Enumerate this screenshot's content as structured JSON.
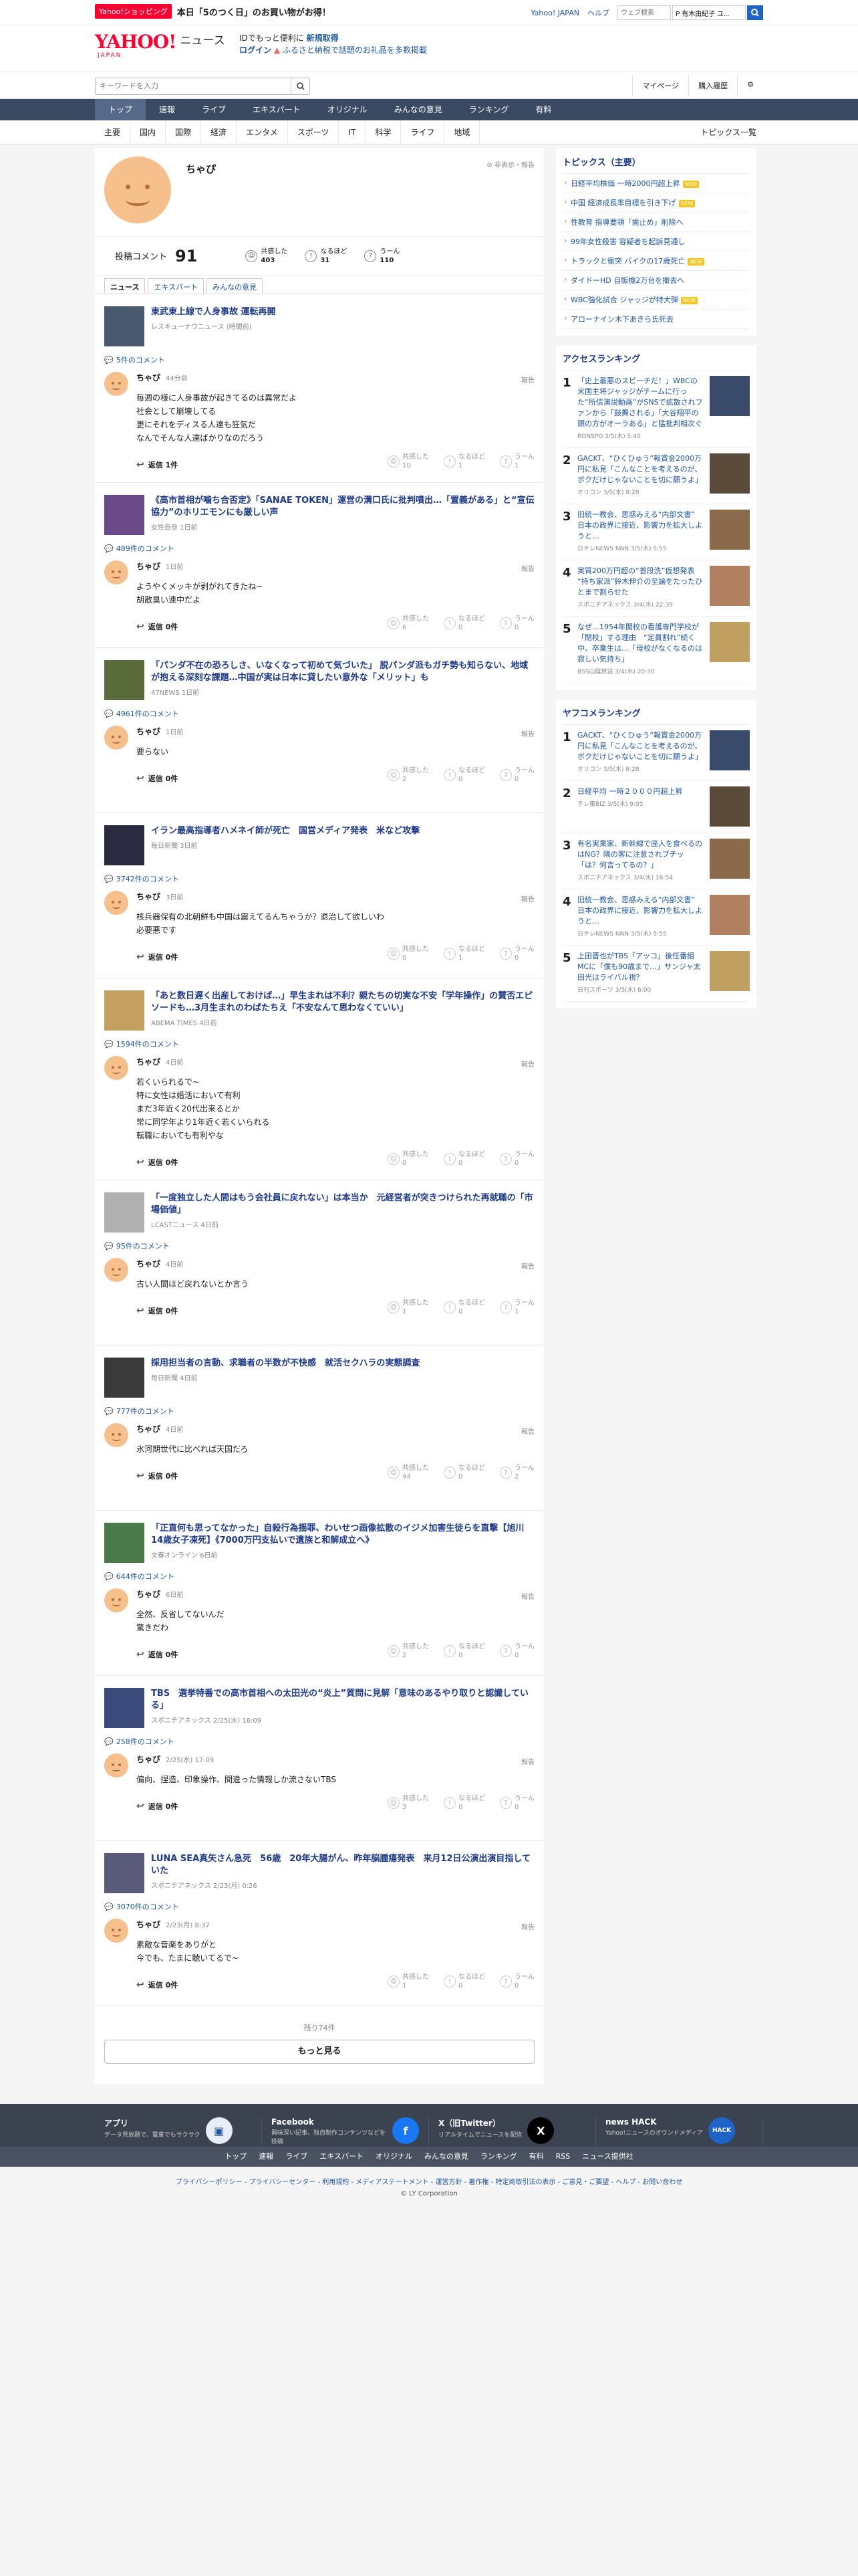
{
  "topbar": {
    "promo_tag": "Yahoo!ショッピング",
    "promo_text": "本日「5のつく日」のお買い物がお得！",
    "links": [
      "Yahoo! JAPAN",
      "ヘルプ"
    ],
    "web_search_placeholder": "ウェブ検索",
    "search_value": "P 有木由紀子 ユ..."
  },
  "header": {
    "logo_yahoo": "YAHOO!",
    "logo_japan": "JAPAN",
    "logo_news": "ニュース",
    "msg1_a": "IDでもっと便利に",
    "msg1_b": "新規取得",
    "msg2_a": "ログイン",
    "msg2_b": "ふるさと納税で話題のお礼品を多数掲載"
  },
  "search": {
    "placeholder": "キーワードを入力",
    "mypage": "マイページ",
    "history": "購入履歴"
  },
  "gnav": [
    "トップ",
    "速報",
    "ライブ",
    "エキスパート",
    "オリジナル",
    "みんなの意見",
    "ランキング",
    "有料"
  ],
  "subnav": [
    "主要",
    "国内",
    "国際",
    "経済",
    "エンタメ",
    "スポーツ",
    "IT",
    "科学",
    "ライフ",
    "地域"
  ],
  "subnav_all": "トピックス一覧",
  "profile": {
    "name": "ちゃぴ",
    "tools": "非表示・報告",
    "posts_label": "投稿コメント",
    "posts": "91",
    "reactions": [
      {
        "label": "共感した",
        "count": "403"
      },
      {
        "label": "なるほど",
        "count": "31"
      },
      {
        "label": "うーん",
        "count": "110"
      }
    ]
  },
  "tabs": [
    "ニュース",
    "エキスパート",
    "みんなの意見"
  ],
  "entries": [
    {
      "title": "東武東上線で人身事故 運転再開",
      "src": "レスキューナウニュース (時間前)",
      "count": "5件のコメント",
      "time": "44分前",
      "body": "毎週の様に人身事故が起きてるのは異常だよ\n社会として崩壊してる\n更にそれをディスる人達も狂気だ\nなんでそんな人達ばかりなのだろう",
      "replies": "返信 1件",
      "r": [
        "10",
        "1",
        "1"
      ]
    },
    {
      "title": "《高市首相が噛ち合否定》「SANAE TOKEN」運営の溝口氏に批判噴出…「置義がある」と“宣伝協力”のホリエモンにも厳しい声",
      "src": "女性自身 1日前",
      "count": "489件のコメント",
      "time": "1日前",
      "body": "ようやくメッキが剥がれてきたね~\n胡散臭い連中だよ",
      "replies": "返信 0件",
      "r": [
        "6",
        "0",
        "0"
      ]
    },
    {
      "title": "「パンダ不在の恐ろしさ、いなくなって初めて気づいた」 脱パンダ派もガチ勢も知らない、地域が抱える深刻な課題…中国が実は日本に貸したい意外な「メリット」も",
      "src": "47NEWS 1日前",
      "count": "4961件のコメント",
      "time": "1日前",
      "body": "要らない",
      "replies": "返信 0件",
      "r": [
        "2",
        "0",
        "0"
      ]
    },
    {
      "title": "イラン最高指導者ハメネイ師が死亡　国営メディア発表　米など攻撃",
      "src": "毎日新聞 3日前",
      "count": "3742件のコメント",
      "time": "3日前",
      "body": "核兵器保有の北朝鮮も中国は震えてるんちゃうか？退治して欲しいわ\n必要悪です",
      "replies": "返信 0件",
      "r": [
        "0",
        "1",
        "0"
      ]
    },
    {
      "title": "「あと数日遅く出産しておけば…」早生まれは不利？親たちの切実な不安「学年操作」の賛否エピソードも…3月生まれのわばたちえ「不安なんて思わなくていい」",
      "src": "ABEMA TIMES 4日前",
      "count": "1594件のコメント",
      "time": "4日前",
      "body": "若くいられるで~\n特に女性は婚活において有利\nまだ3年近く20代出来るとか\n常に同学年より1年近く若くいられる\n転職においても有利やな",
      "replies": "返信 0件",
      "r": [
        "0",
        "0",
        "0"
      ]
    },
    {
      "title": "「一度独立した人間はもう会社員に戻れない」は本当か　元経営者が突きつけられた再就職の「市場価値」",
      "src": "LCASTニュース 4日前",
      "count": "95件のコメント",
      "time": "4日前",
      "body": "古い人間ほど戻れないとか言う",
      "replies": "返信 0件",
      "r": [
        "1",
        "0",
        "1"
      ]
    },
    {
      "title": "採用担当者の言動、求職者の半数が不快感　就活セクハラの実態調査",
      "src": "毎日新聞 4日前",
      "count": "777件のコメント",
      "time": "4日前",
      "body": "氷河期世代に比べれば天国だろ",
      "replies": "返信 0件",
      "r": [
        "44",
        "0",
        "2"
      ]
    },
    {
      "title": "「正直何も思ってなかった」自殺行為揺罪、わいせつ画像拡散のイジメ加害生徒らを直撃【旭川14歳女子凍死】《7000万円支払いで遺族と和解成立へ》",
      "src": "文春オンライン 6日前",
      "count": "644件のコメント",
      "time": "6日前",
      "body": "全然、反省してないんだ\n驚きだわ",
      "replies": "返信 0件",
      "r": [
        "2",
        "0",
        "0"
      ]
    },
    {
      "title": "TBS　選挙特番での高市首相への太田光の“炎上”質問に見解「意味のあるやり取りと認識している」",
      "src": "スポニチアネックス 2/25(水) 16:09",
      "count": "258件のコメント",
      "time": "2/25(水) 17:09",
      "body": "偏向、捏造、印象操作、間違った情報しか流さないTBS",
      "replies": "返信 0件",
      "r": [
        "3",
        "0",
        "0"
      ]
    },
    {
      "title": "LUNA SEA真矢さん急死　56歳　20年大腸がん、昨年脳腫瘍発表　来月12日公演出演目指していた",
      "src": "スポニチアネックス 2/23(月) 0:26",
      "count": "3070件のコメント",
      "time": "2/23(月) 8:37",
      "body": "素敵な音楽をありがと\n今でも、たまに聴いてるで~",
      "replies": "返信 0件",
      "r": [
        "1",
        "0",
        "0"
      ]
    }
  ],
  "more": {
    "remaining": "残り74件",
    "button": "もっと見る"
  },
  "right": {
    "topics_head": "トピックス（主要）",
    "topics": [
      {
        "t": "日経平均株価 一時2000円超上昇",
        "n": true
      },
      {
        "t": "中国 経済成長率目標を引き下げ",
        "n": true
      },
      {
        "t": "性教育 指導要領「歯止め」削除へ",
        "n": false
      },
      {
        "t": "99年女性殺害 容疑者を起訴見通し",
        "n": false
      },
      {
        "t": "トラックと衝突 バイクの17歳死亡",
        "n": true
      },
      {
        "t": "ダイドーHD 自販機2万台を撤去へ",
        "n": false
      },
      {
        "t": "WBC強化試合 ジャッジが特大弾",
        "n": true
      },
      {
        "t": "アローナイン木下あきら氏死去",
        "n": false
      }
    ],
    "access_head": "アクセスランキング",
    "access": [
      {
        "no": "1",
        "t": "「史上最悪のスピーチだ！」WBCの米国主将ジャッジがチームに行った“所信演説動画”がSNSで拡散されファンから「鼓舞される」「大谷翔平の頭の方がオーラある」と猛批判相次ぐ",
        "s": "RONSPO 3/5(木) 5:40"
      },
      {
        "no": "2",
        "t": "GACKT、“ひくひゅう”報賞金2000万円に私見「こんなことを考えるのが、ボクだけじゃないことを切に願うよ」",
        "s": "オリコン 3/5(木) 8:28"
      },
      {
        "no": "3",
        "t": "旧統一教会、思惑みえる“内部文書” 日本の政界に接近、影響力を拡大しようと…",
        "s": "日テレNEWS NNN 3/5(木) 5:55"
      },
      {
        "no": "4",
        "t": "実質200万円超の“普段洗”仮想発表 “持ち家派”鈴木伸介の至論をたったひとまで割らせた",
        "s": "スポニチアネックス 3/4(水) 22:39"
      },
      {
        "no": "5",
        "t": "なぜ…1954年開校の看護専門学校が「閉校」する理由　“定員割れ”続く中、卒業生は…「母校がなくなるのは寂しい気持ち」",
        "s": "BSS山陰放送 3/4(水) 20:30"
      }
    ],
    "yafuko_head": "ヤフコメランキング",
    "yafuko": [
      {
        "no": "1",
        "t": "GACKT、“ひくひゅう”報賞金2000万円に私見「こんなことを考えるのが、ボクだけじゃないことを切に願うよ」",
        "s": "オリコン 3/5(木) 8:28"
      },
      {
        "no": "2",
        "t": "日経平均 一時２０００円超上昇",
        "s": "テレ東BIZ 3/5(木) 9:05"
      },
      {
        "no": "3",
        "t": "有名実業家、新幹線で座人を食べるのはNG？隣の客に注意されブチッ「は？何言ってるの？」",
        "s": "スポニチアネックス 3/4(水) 16:54"
      },
      {
        "no": "4",
        "t": "旧統一教会、思惑みえる“内部文書” 日本の政界に接近、影響力を拡大しようと…",
        "s": "日テレNEWS NNN 3/5(木) 5:55"
      },
      {
        "no": "5",
        "t": "上田晋也がTBS「アッコ」後任番組MCに「僕も90歳まで…」サンジャ太田光はライバル視？",
        "s": "日刊スポーツ 3/5(木) 6:00"
      }
    ]
  },
  "footer": {
    "apps": [
      {
        "t": "アプリ",
        "d": "データ見放題で、電車でもサクサク"
      },
      {
        "t": "Facebook",
        "d": "興味深い記事、独自制作コンテンツなどを投稿"
      },
      {
        "t": "X（旧Twitter）",
        "d": "リアルタイムでニュースを配信"
      },
      {
        "t": "news HACK",
        "d": "Yahoo!ニュースのオウンドメディア"
      }
    ],
    "nav": [
      "トップ",
      "速報",
      "ライブ",
      "エキスパート",
      "オリジナル",
      "みんなの意見",
      "ランキング",
      "有料",
      "RSS",
      "ニュース提供社"
    ],
    "links": "プライバシーポリシー - プライバシーセンター - 利用規約 - メディアステートメント - 運営方針 - 著作権 - 特定商取引法の表示 - ご意見・ご要望 - ヘルプ - お問い合わせ",
    "copy": "© LY Corporation"
  }
}
